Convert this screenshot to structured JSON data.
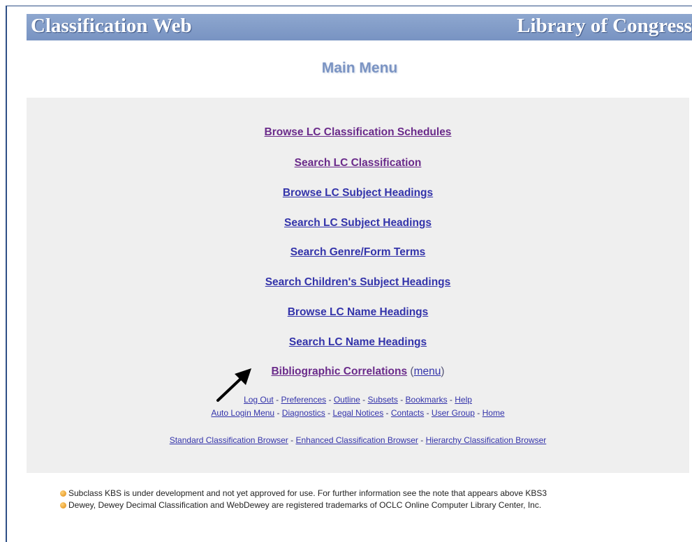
{
  "header": {
    "app_title": "Classification Web",
    "org_title": "Library of Congress"
  },
  "page_title": "Main Menu",
  "main_menu": {
    "items": [
      {
        "label": "Browse LC Classification Schedules",
        "visited": true
      },
      {
        "label": "Search LC Classification",
        "visited": true
      },
      {
        "label": "Browse LC Subject Headings",
        "visited": false
      },
      {
        "label": "Search LC Subject Headings",
        "visited": false
      },
      {
        "label": "Search Genre/Form Terms",
        "visited": false
      },
      {
        "label": "Search Children's Subject Headings",
        "visited": false
      },
      {
        "label": "Browse LC Name Headings",
        "visited": false
      },
      {
        "label": "Search LC Name Headings",
        "visited": false
      }
    ],
    "bib_correlations": {
      "label": "Bibliographic Correlations",
      "paren_open": "(",
      "menu_label": "menu",
      "paren_close": ")"
    }
  },
  "utility_links": {
    "row1": [
      "Log Out",
      "Preferences",
      "Outline",
      "Subsets",
      "Bookmarks",
      "Help"
    ],
    "row2": [
      "Auto Login Menu",
      "Diagnostics",
      "Legal Notices",
      "Contacts",
      "User Group",
      "Home"
    ],
    "separator": " - "
  },
  "browser_links": [
    "Standard Classification Browser",
    "Enhanced Classification Browser",
    "Hierarchy Classification Browser"
  ],
  "notes": [
    "Subclass KBS is under development and not yet approved for use. For further information see the note that appears above KBS3",
    "Dewey, Dewey Decimal Classification and WebDewey are registered trademarks of OCLC Online Computer Library Center, Inc."
  ],
  "colors": {
    "banner": "#7893c2",
    "link": "#3333aa",
    "visited_link": "#6a2a8a",
    "panel": "#efefef",
    "note_bullet": "#e08a10"
  }
}
